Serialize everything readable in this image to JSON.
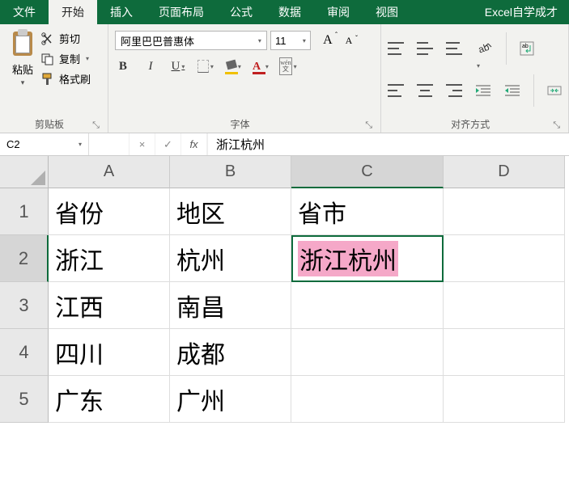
{
  "tabs": {
    "file": "文件",
    "home": "开始",
    "insert": "插入",
    "layout": "页面布局",
    "formulas": "公式",
    "data": "数据",
    "review": "审阅",
    "view": "视图",
    "right": "Excel自学成才"
  },
  "ribbon": {
    "clipboard": {
      "paste": "粘贴",
      "cut": "剪切",
      "copy": "复制",
      "format_painter": "格式刷",
      "group_label": "剪贴板"
    },
    "font": {
      "name": "阿里巴巴普惠体",
      "size": "11",
      "wen_top": "wén",
      "wen_bottom": "文",
      "group_label": "字体"
    },
    "align": {
      "wrap": "ab",
      "merge_icon": "⇔",
      "group_label": "对齐方式"
    }
  },
  "formula_bar": {
    "name_box": "C2",
    "cancel": "×",
    "confirm": "✓",
    "fx": "fx",
    "value": "浙江杭州"
  },
  "columns": {
    "A": "A",
    "B": "B",
    "C": "C",
    "D": "D"
  },
  "rows": {
    "r1": "1",
    "r2": "2",
    "r3": "3",
    "r4": "4",
    "r5": "5"
  },
  "cells": {
    "A1": "省份",
    "B1": "地区",
    "C1": "省市",
    "A2": "浙江",
    "B2": "杭州",
    "C2": "浙江杭州",
    "A3": "江西",
    "B3": "南昌",
    "A4": "四川",
    "B4": "成都",
    "A5": "广东",
    "B5": "广州"
  }
}
